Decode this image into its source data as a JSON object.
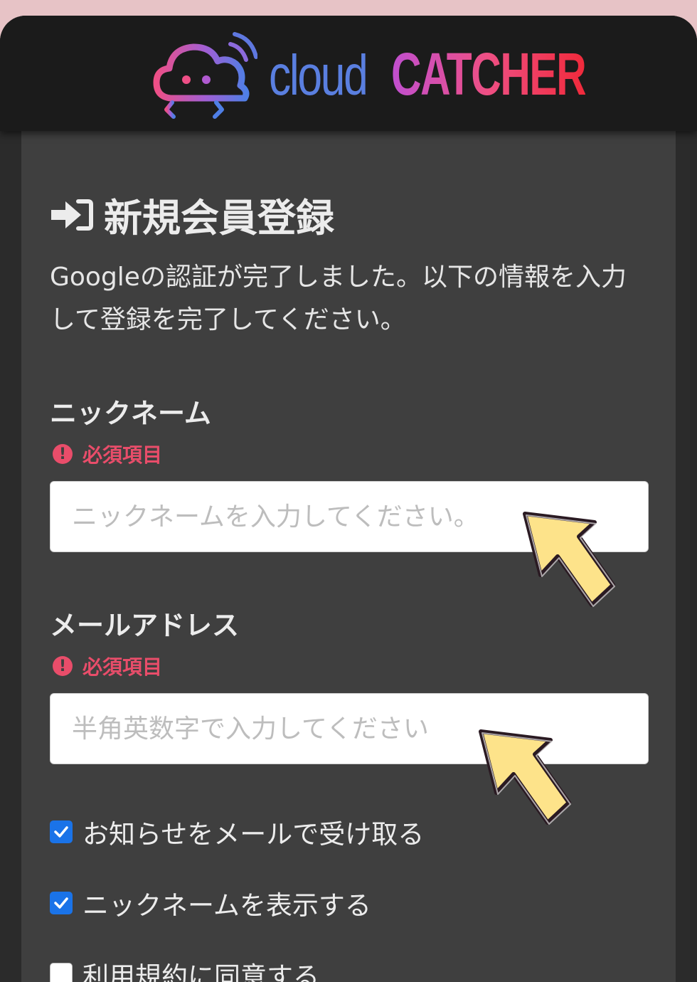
{
  "header": {
    "logo_part1": "cloud",
    "logo_part2": "CATCHER",
    "logo_icon": "cloud-robot-logo-icon"
  },
  "form": {
    "title": "新規会員登録",
    "title_icon": "sign-in-icon",
    "description": "Googleの認証が完了しました。以下の情報を入力して登録を完了してください。",
    "required_text": "必須項目",
    "nickname": {
      "label": "ニックネーム",
      "value": "",
      "placeholder": "ニックネームを入力してください。"
    },
    "email": {
      "label": "メールアドレス",
      "value": "",
      "placeholder": "半角英数字で入力してください"
    },
    "checkboxes": [
      {
        "label": "お知らせをメールで受け取る",
        "checked": true
      },
      {
        "label": "ニックネームを表示する",
        "checked": true
      },
      {
        "label": "利用規約に同意する",
        "checked": false
      }
    ]
  },
  "colors": {
    "accent_blue": "#1a73e8",
    "required_red": "#e94d6a",
    "pointer_yellow": "#fde38a"
  }
}
